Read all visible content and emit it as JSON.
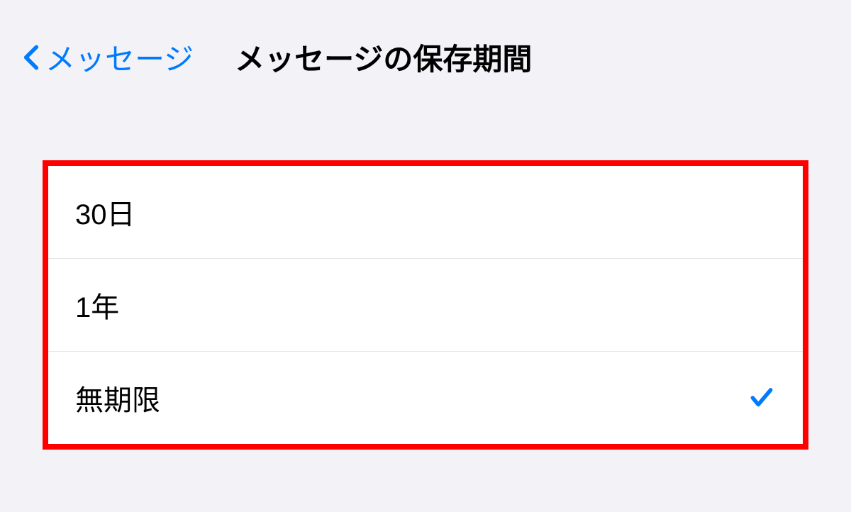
{
  "header": {
    "back_label": "メッセージ",
    "title": "メッセージの保存期間"
  },
  "options": [
    {
      "label": "30日",
      "selected": false
    },
    {
      "label": "1年",
      "selected": false
    },
    {
      "label": "無期限",
      "selected": true
    }
  ],
  "colors": {
    "accent": "#007aff",
    "highlight_border": "#ff0000"
  }
}
